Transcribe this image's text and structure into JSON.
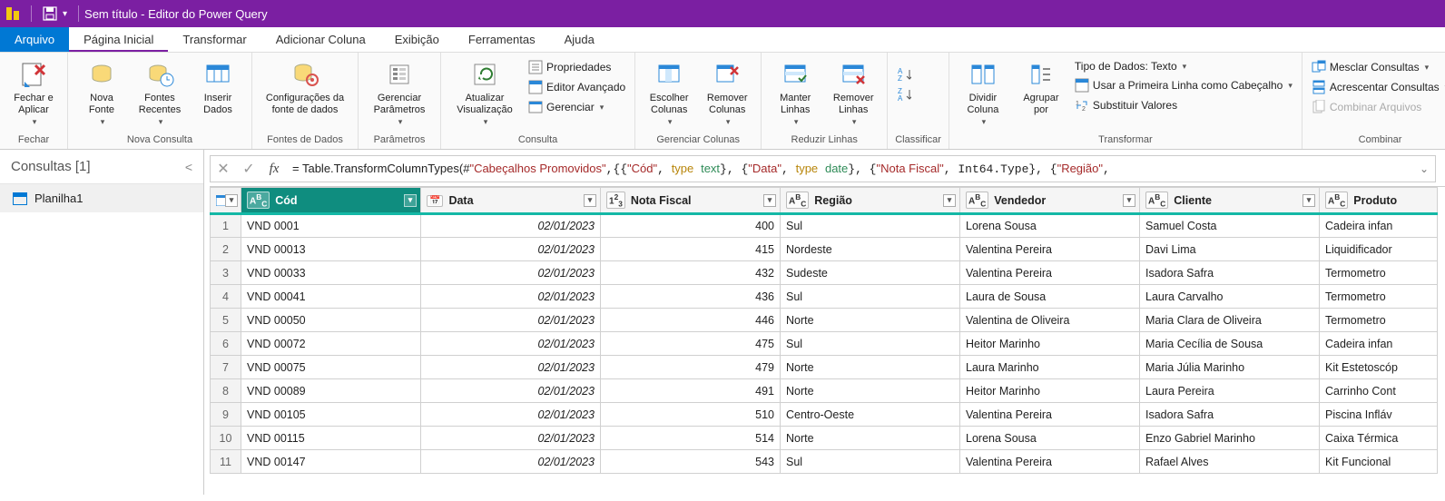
{
  "title": "Sem título - Editor do Power Query",
  "tabs": {
    "file": "Arquivo",
    "home": "Página Inicial",
    "transform": "Transformar",
    "addcol": "Adicionar Coluna",
    "view": "Exibição",
    "tools": "Ferramentas",
    "help": "Ajuda"
  },
  "ribbon": {
    "close": {
      "label": "Fechar e\nAplicar",
      "group": "Fechar"
    },
    "newsource": "Nova\nFonte",
    "recents": "Fontes\nRecentes",
    "enterdata": "Inserir\nDados",
    "newquery_group": "Nova Consulta",
    "datasource": "Configurações da\nfonte de dados",
    "datasources_group": "Fontes de Dados",
    "params": "Gerenciar\nParâmetros",
    "params_group": "Parâmetros",
    "refresh": "Atualizar\nVisualização",
    "props": "Propriedades",
    "adveditor": "Editor Avançado",
    "manage": "Gerenciar",
    "query_group": "Consulta",
    "choosecols": "Escolher\nColunas",
    "removecols": "Remover\nColunas",
    "managecols_group": "Gerenciar Colunas",
    "keeprows": "Manter\nLinhas",
    "removerows": "Remover\nLinhas",
    "reducerows_group": "Reduzir Linhas",
    "sort_group": "Classificar",
    "splitcol": "Dividir\nColuna",
    "groupby": "Agrupar\npor",
    "datatype": "Tipo de Dados: Texto",
    "firstrowheader": "Usar a Primeira Linha como Cabeçalho",
    "replacevals": "Substituir Valores",
    "transform_group": "Transformar",
    "merge": "Mesclar Consultas",
    "append": "Acrescentar Consultas",
    "combinefiles": "Combinar Arquivos",
    "combine_group": "Combinar"
  },
  "queries": {
    "header": "Consultas [1]",
    "item": "Planilha1"
  },
  "formula_prefix": "= Table.TransformColumnTypes(#",
  "columns": [
    "Cód",
    "Data",
    "Nota Fiscal",
    "Região",
    "Vendedor",
    "Cliente",
    "Produto"
  ],
  "rows": [
    {
      "n": 1,
      "cod": "VND 0001",
      "data": "02/01/2023",
      "nf": "400",
      "regiao": "Sul",
      "vend": "Lorena Sousa",
      "cli": "Samuel Costa",
      "prod": "Cadeira infan"
    },
    {
      "n": 2,
      "cod": "VND 00013",
      "data": "02/01/2023",
      "nf": "415",
      "regiao": "Nordeste",
      "vend": "Valentina Pereira",
      "cli": "Davi Lima",
      "prod": "Liquidificador"
    },
    {
      "n": 3,
      "cod": "VND 00033",
      "data": "02/01/2023",
      "nf": "432",
      "regiao": "Sudeste",
      "vend": "Valentina Pereira",
      "cli": "Isadora Safra",
      "prod": "Termometro"
    },
    {
      "n": 4,
      "cod": "VND 00041",
      "data": "02/01/2023",
      "nf": "436",
      "regiao": "Sul",
      "vend": "Laura de Sousa",
      "cli": "Laura Carvalho",
      "prod": "Termometro"
    },
    {
      "n": 5,
      "cod": "VND 00050",
      "data": "02/01/2023",
      "nf": "446",
      "regiao": "Norte",
      "vend": "Valentina de Oliveira",
      "cli": "Maria Clara de Oliveira",
      "prod": "Termometro"
    },
    {
      "n": 6,
      "cod": "VND 00072",
      "data": "02/01/2023",
      "nf": "475",
      "regiao": "Sul",
      "vend": "Heitor Marinho",
      "cli": "Maria Cecília de Sousa",
      "prod": "Cadeira infan"
    },
    {
      "n": 7,
      "cod": "VND 00075",
      "data": "02/01/2023",
      "nf": "479",
      "regiao": "Norte",
      "vend": "Laura Marinho",
      "cli": "Maria Júlia Marinho",
      "prod": "Kit Estetoscóp"
    },
    {
      "n": 8,
      "cod": "VND 00089",
      "data": "02/01/2023",
      "nf": "491",
      "regiao": "Norte",
      "vend": "Heitor Marinho",
      "cli": "Laura Pereira",
      "prod": "Carrinho Cont"
    },
    {
      "n": 9,
      "cod": "VND 00105",
      "data": "02/01/2023",
      "nf": "510",
      "regiao": "Centro-Oeste",
      "vend": "Valentina Pereira",
      "cli": "Isadora Safra",
      "prod": "Piscina Infláv"
    },
    {
      "n": 10,
      "cod": "VND 00115",
      "data": "02/01/2023",
      "nf": "514",
      "regiao": "Norte",
      "vend": "Lorena Sousa",
      "cli": "Enzo Gabriel Marinho",
      "prod": "Caixa Térmica"
    },
    {
      "n": 11,
      "cod": "VND 00147",
      "data": "02/01/2023",
      "nf": "543",
      "regiao": "Sul",
      "vend": "Valentina Pereira",
      "cli": "Rafael Alves",
      "prod": "Kit Funcional"
    }
  ]
}
